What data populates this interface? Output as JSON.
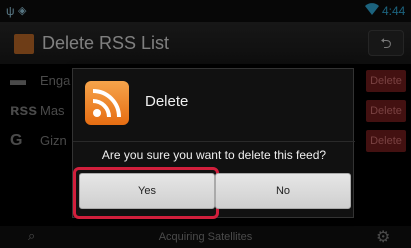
{
  "status_bar": {
    "time": "4:44"
  },
  "title_bar": {
    "title": "Delete RSS List",
    "back_glyph": "⮌"
  },
  "list": {
    "items": [
      {
        "name": "Enga",
        "icon": "▬",
        "delete_label": "Delete"
      },
      {
        "name": "Mas",
        "icon": "ʀss",
        "delete_label": "Delete"
      },
      {
        "name": "Gizn",
        "icon": "G",
        "delete_label": "Delete"
      }
    ]
  },
  "dialog": {
    "title": "Delete",
    "message": "Are you sure you want to delete this feed?",
    "yes_label": "Yes",
    "no_label": "No"
  },
  "bottom_bar": {
    "status": "Acquiring Satellites"
  },
  "colors": {
    "accent": "#33b5e5",
    "highlight": "#d21f3c",
    "rss": "#e66d12"
  }
}
